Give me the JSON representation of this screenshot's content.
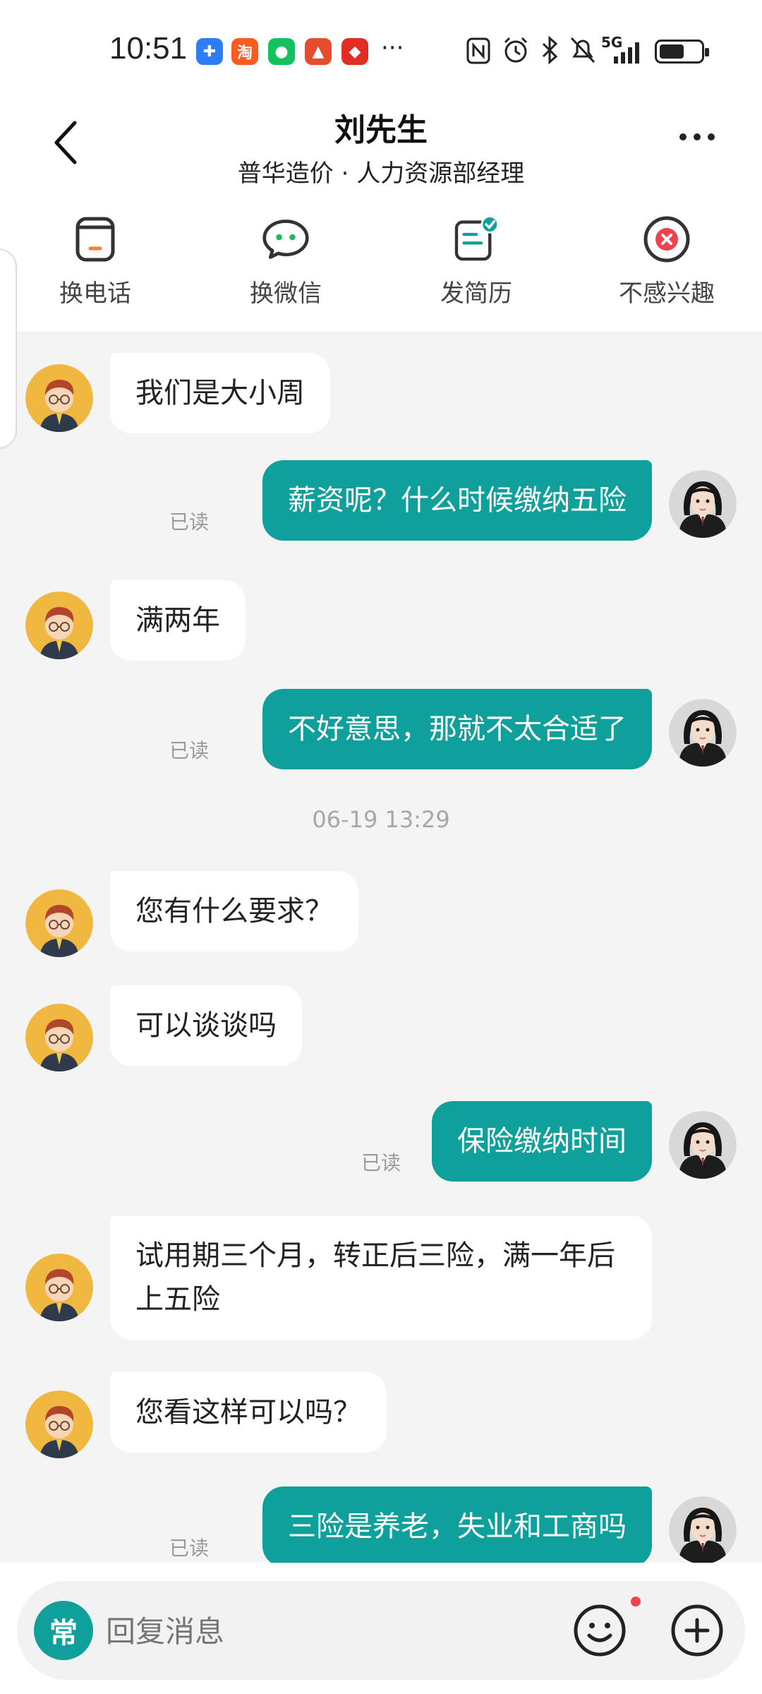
{
  "status_bar": {
    "time": "10:51",
    "more": "···",
    "network": "5G",
    "app_icons": [
      {
        "name": "blue-app-icon",
        "color": "#2f7df6",
        "glyph": "✚"
      },
      {
        "name": "taobao-icon",
        "color": "#ff5a1f",
        "glyph": "淘"
      },
      {
        "name": "wechat-icon",
        "color": "#13c15f",
        "glyph": "✉"
      },
      {
        "name": "red-app-icon",
        "color": "#e54d2e",
        "glyph": "▲"
      },
      {
        "name": "pinduoduo-icon",
        "color": "#e02e24",
        "glyph": "◆"
      }
    ]
  },
  "header": {
    "title": "刘先生",
    "subtitle": "普华造价 · 人力资源部经理"
  },
  "actions": [
    {
      "label": "换电话",
      "icon": "phone-icon"
    },
    {
      "label": "换微信",
      "icon": "wechat-bubble-icon"
    },
    {
      "label": "发简历",
      "icon": "resume-icon"
    },
    {
      "label": "不感兴趣",
      "icon": "not-interested-icon"
    }
  ],
  "messages": {
    "m1": "我们是大小周",
    "m2": "薪资呢？什么时候缴纳五险",
    "m3": "满两年",
    "m4": "不好意思，那就不太合适了",
    "ts": "06-19 13:29",
    "m5": "您有什么要求？",
    "m6": "可以谈谈吗",
    "m7": "保险缴纳时间",
    "m8": "试用期三个月，转正后三险，满一年后上五险",
    "m9": "您看这样可以吗？",
    "m10": "三险是养老，失业和工商吗",
    "read_label": "已读"
  },
  "input": {
    "common_label": "常",
    "placeholder": "回复消息"
  },
  "colors": {
    "accent": "#0fa09c",
    "chat_bg": "#f4f4f4",
    "badge": "#f0424d"
  }
}
